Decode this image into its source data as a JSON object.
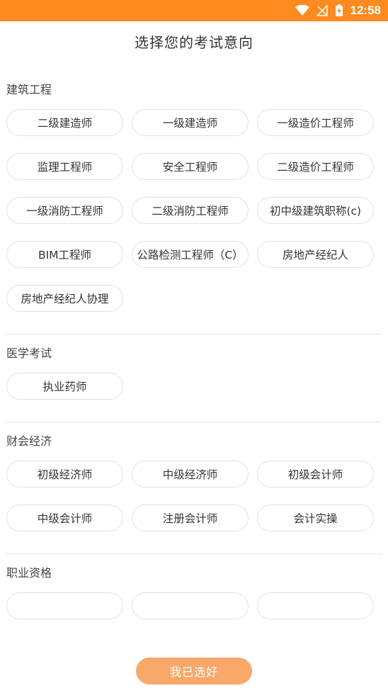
{
  "status_bar": {
    "time": "12:58",
    "icons": [
      "wifi-icon",
      "signal-off-icon",
      "battery-charging-icon"
    ],
    "color": "#ff8a1f"
  },
  "header": {
    "title": "选择您的考试意向"
  },
  "sections": [
    {
      "title": "建筑工程",
      "items": [
        "二级建造师",
        "一级建造师",
        "一级造价工程师",
        "监理工程师",
        "安全工程师",
        "二级造价工程师",
        "一级消防工程师",
        "二级消防工程师",
        "初中级建筑职称(c)",
        "BIM工程师",
        "公路检测工程师（C）",
        "房地产经纪人",
        "房地产经纪人协理"
      ]
    },
    {
      "title": "医学考试",
      "items": [
        "执业药师"
      ]
    },
    {
      "title": "财会经济",
      "items": [
        "初级经济师",
        "中级经济师",
        "初级会计师",
        "中级会计师",
        "注册会计师",
        "会计实操"
      ]
    },
    {
      "title": "职业资格",
      "items": [
        "",
        "",
        ""
      ]
    }
  ],
  "footer": {
    "confirm_label": "我已选好",
    "button_color": "#f9a86a"
  }
}
